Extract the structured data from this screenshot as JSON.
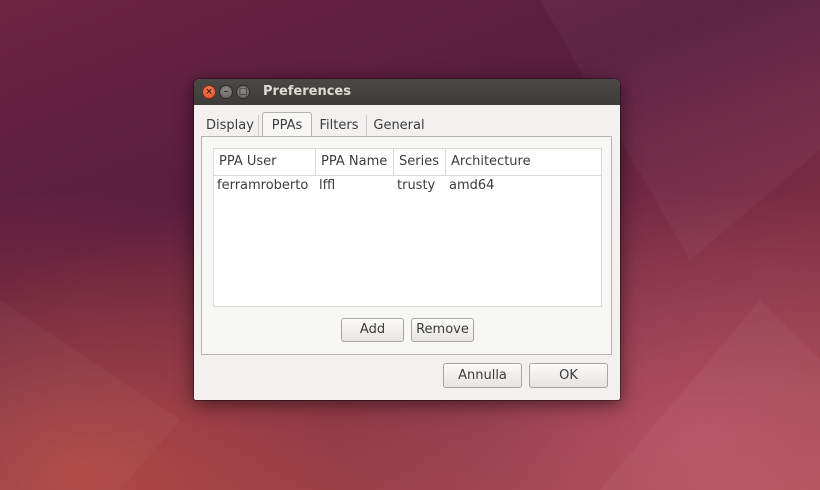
{
  "window": {
    "title": "Preferences",
    "controls": {
      "close": "×",
      "minimize": "–",
      "maximize": "□"
    }
  },
  "tabs": [
    {
      "label": "Display",
      "active": false
    },
    {
      "label": "PPAs",
      "active": true
    },
    {
      "label": "Filters",
      "active": false
    },
    {
      "label": "General",
      "active": false
    }
  ],
  "ppa_table": {
    "columns": [
      "PPA User",
      "PPA Name",
      "Series",
      "Architecture"
    ],
    "rows": [
      [
        "ferramroberto",
        "lffl",
        "trusty",
        "amd64"
      ]
    ]
  },
  "actions": {
    "add_label": "Add",
    "remove_label": "Remove"
  },
  "dialog_buttons": {
    "cancel_label": "Annulla",
    "ok_label": "OK"
  }
}
